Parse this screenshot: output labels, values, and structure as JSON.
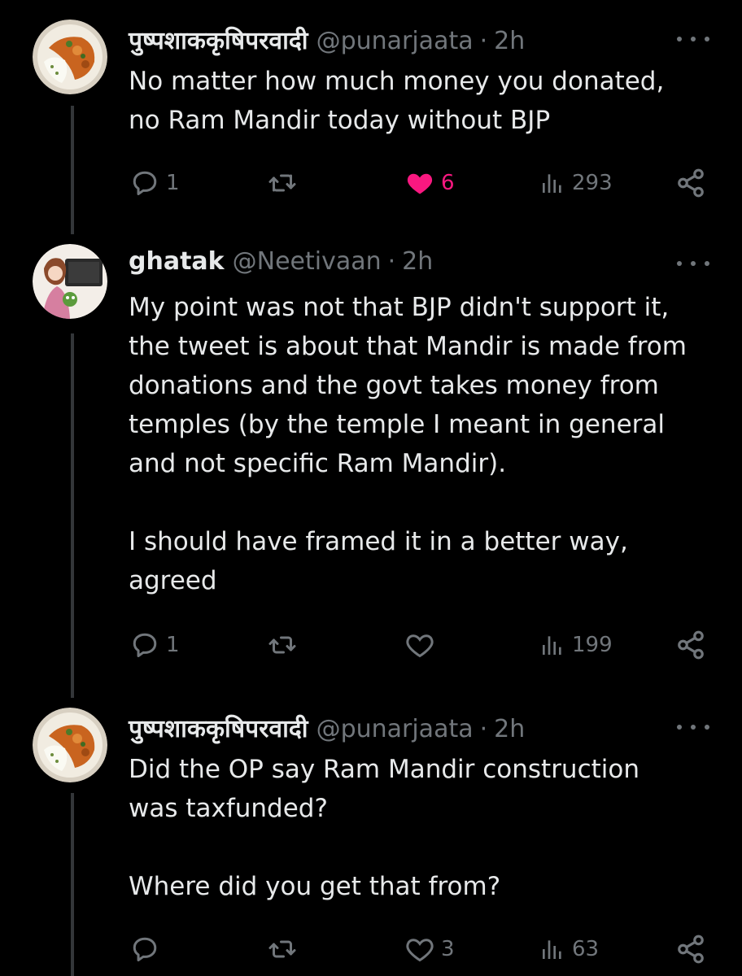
{
  "tweets": [
    {
      "name": "पुष्पशाककृषिपरवादी",
      "handle": "@punarjaata",
      "time": "2h",
      "text": "No matter how much money you donated,\nno Ram Mandir today without BJP",
      "actions": {
        "reply_count": "1",
        "retweet_count": "",
        "like_count": "6",
        "liked": true,
        "views_count": "293"
      },
      "avatar": "food-avatar"
    },
    {
      "name": "ghatak",
      "handle": "@Neetivaan",
      "time": "2h",
      "text": "My point was not that BJP didn't support it,\nthe tweet is about that Mandir is made from\ndonations and the govt takes money from\ntemples (by the temple I meant in general\nand not specific Ram Mandir).\n\nI should have framed it in a better way,\nagreed",
      "actions": {
        "reply_count": "1",
        "retweet_count": "",
        "like_count": "",
        "liked": false,
        "views_count": "199"
      },
      "avatar": "anime-avatar"
    },
    {
      "name": "पुष्पशाककृषिपरवादी",
      "handle": "@punarjaata",
      "time": "2h",
      "text": "Did the OP say Ram Mandir construction\nwas taxfunded?\n\nWhere did you get that from?",
      "actions": {
        "reply_count": "",
        "retweet_count": "",
        "like_count": "3",
        "liked": false,
        "views_count": "63"
      },
      "avatar": "food-avatar"
    }
  ],
  "colors": {
    "background": "#000000",
    "text_primary": "#e7e9ea",
    "text_secondary": "#71767b",
    "like_active": "#f91880",
    "thread_line": "#333639"
  },
  "icons": {
    "reply": "reply-icon",
    "retweet": "retweet-icon",
    "like": "heart-icon",
    "views": "views-icon",
    "share": "share-icon",
    "more": "more-icon"
  }
}
